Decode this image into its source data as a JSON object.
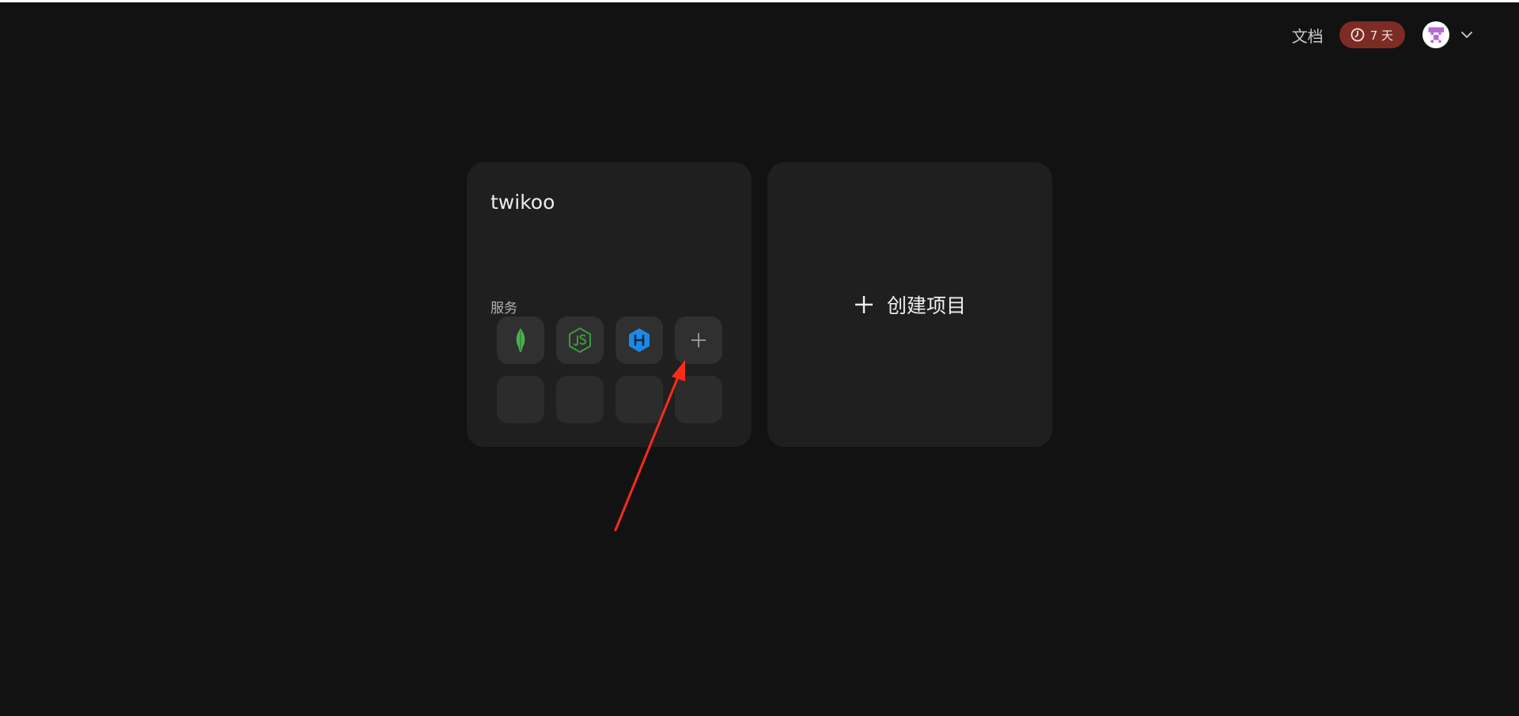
{
  "header": {
    "docs_label": "文档",
    "trial_badge": {
      "icon": "clock-icon",
      "label": "7 天",
      "color": "#7c2b25"
    },
    "user_menu": {
      "avatar_icon": "pixel-avatar-icon",
      "dropdown_icon": "chevron-down-icon"
    }
  },
  "project_card": {
    "name": "twikoo",
    "services_label": "服务",
    "services": [
      {
        "icon": "mongodb-leaf-icon",
        "color": "#4caf50"
      },
      {
        "icon": "nodejs-icon",
        "color": "#3c9a3c"
      },
      {
        "icon": "hexagon-h-icon",
        "color": "#1e88e5"
      },
      {
        "icon": "plus-icon",
        "color": "#9e9e9e"
      }
    ],
    "empty_slots": 4
  },
  "create_card": {
    "label": "创建项目",
    "icon": "plus-icon"
  },
  "colors": {
    "background": "#121212",
    "card": "#1f1f1f",
    "tile": "#303030",
    "annotation": "#ff2a1a"
  }
}
